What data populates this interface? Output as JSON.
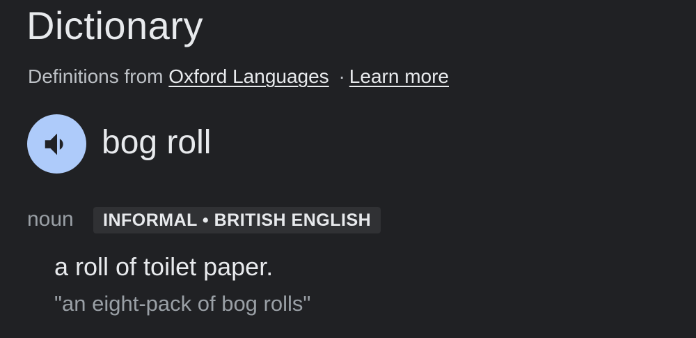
{
  "dictionary": {
    "title": "Dictionary",
    "source_prefix": "Definitions from",
    "source_link": "Oxford Languages",
    "separator": "·",
    "learn_more": "Learn more"
  },
  "entry": {
    "word": "bog roll",
    "speaker_icon": "volume-icon",
    "part_of_speech": "noun",
    "labels": "INFORMAL • BRITISH ENGLISH",
    "definition": "a roll of toilet paper.",
    "example": "\"an eight-pack of bog rolls\""
  },
  "colors": {
    "background": "#202124",
    "speaker_circle": "#aecbfa",
    "badge_background": "#303134"
  }
}
